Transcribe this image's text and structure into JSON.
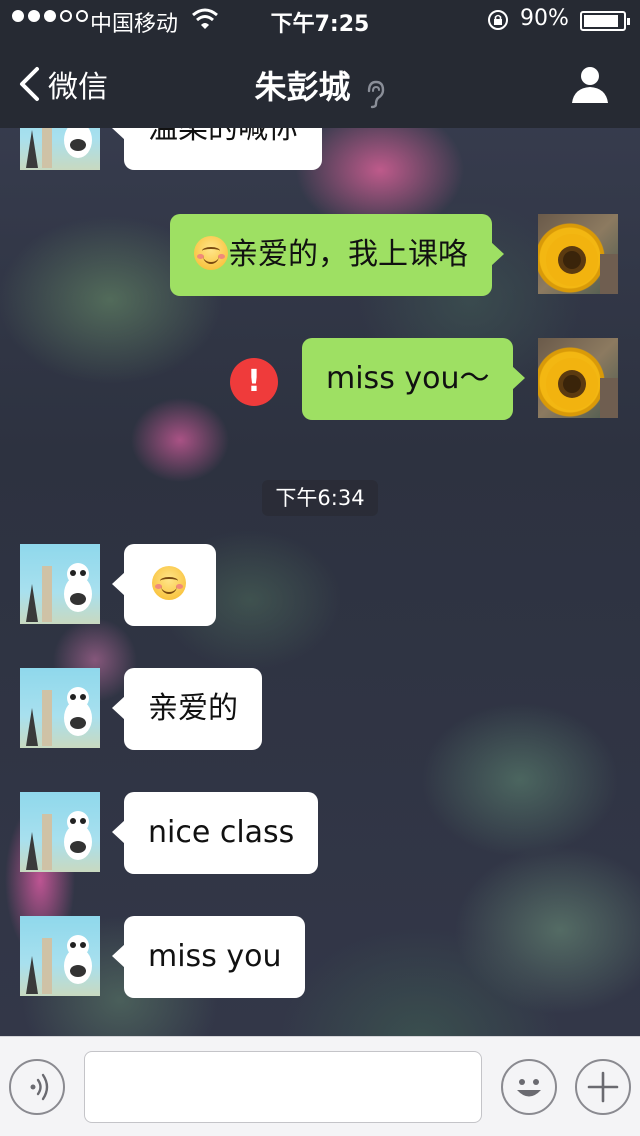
{
  "status_bar": {
    "carrier": "中国移动",
    "time": "下午7:25",
    "battery_percent": "90%",
    "battery_level": 0.9,
    "signal_filled": 3,
    "signal_total": 5
  },
  "nav": {
    "back_label": "微信",
    "title": "朱彭城",
    "icons": [
      "chevron-left-icon",
      "ear-icon",
      "person-icon"
    ]
  },
  "messages": [
    {
      "from": "friend",
      "text": "温柔的喊你"
    },
    {
      "from": "me",
      "emoji": "smile",
      "text": "亲爱的，我上课咯"
    },
    {
      "from": "me",
      "text": "miss you～",
      "failed": true
    },
    {
      "from": "friend",
      "emoji": "smile",
      "text": ""
    },
    {
      "from": "friend",
      "text": "亲爱的"
    },
    {
      "from": "friend",
      "text": "nice class"
    },
    {
      "from": "friend",
      "text": "miss you"
    }
  ],
  "timestamp": "下午6:34",
  "input_bar": {
    "placeholder": "",
    "icons": [
      "voice-icon",
      "emoji-icon",
      "plus-icon"
    ]
  },
  "colors": {
    "bar": "#262a33",
    "bubble_out": "#9ee063",
    "bubble_in": "#ffffff",
    "error": "#ef3b3b"
  }
}
